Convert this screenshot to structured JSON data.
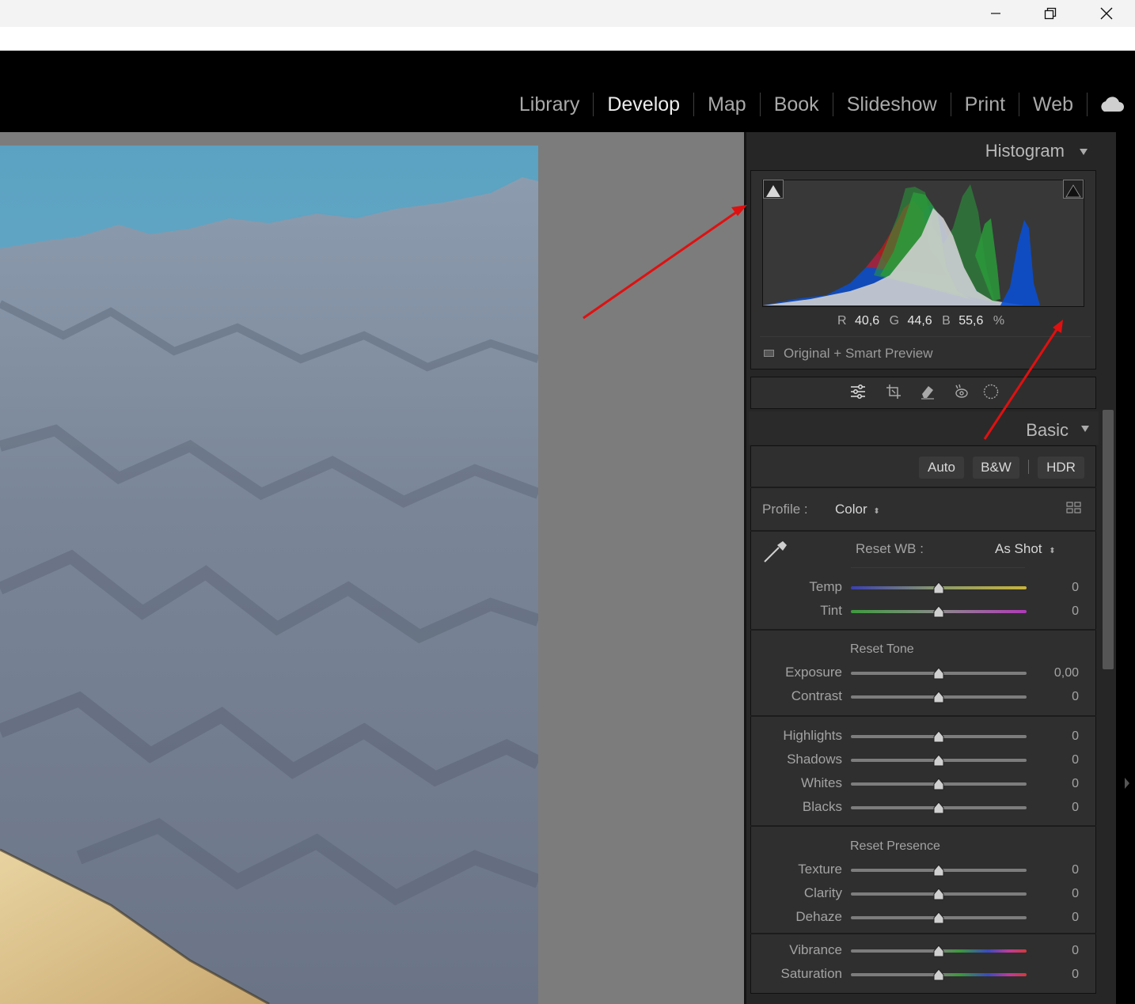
{
  "modules": [
    "Library",
    "Develop",
    "Map",
    "Book",
    "Slideshow",
    "Print",
    "Web"
  ],
  "active_module": "Develop",
  "histogram": {
    "title": "Histogram",
    "r_label": "R",
    "r_value": "40,6",
    "g_label": "G",
    "g_value": "44,6",
    "b_label": "B",
    "b_value": "55,6",
    "unit": "%",
    "preview_status": "Original + Smart Preview"
  },
  "basic": {
    "title": "Basic",
    "auto": "Auto",
    "bw": "B&W",
    "hdr": "HDR",
    "profile_label": "Profile :",
    "profile_value": "Color",
    "reset_wb": "Reset WB :",
    "wb_value": "As Shot",
    "reset_tone": "Reset Tone",
    "reset_presence": "Reset Presence",
    "sliders": {
      "temp": {
        "label": "Temp",
        "value": "0"
      },
      "tint": {
        "label": "Tint",
        "value": "0"
      },
      "exposure": {
        "label": "Exposure",
        "value": "0,00"
      },
      "contrast": {
        "label": "Contrast",
        "value": "0"
      },
      "highlights": {
        "label": "Highlights",
        "value": "0"
      },
      "shadows": {
        "label": "Shadows",
        "value": "0"
      },
      "whites": {
        "label": "Whites",
        "value": "0"
      },
      "blacks": {
        "label": "Blacks",
        "value": "0"
      },
      "texture": {
        "label": "Texture",
        "value": "0"
      },
      "clarity": {
        "label": "Clarity",
        "value": "0"
      },
      "dehaze": {
        "label": "Dehaze",
        "value": "0"
      },
      "vibrance": {
        "label": "Vibrance",
        "value": "0"
      },
      "saturation": {
        "label": "Saturation",
        "value": "0"
      }
    }
  },
  "colors": {
    "annotation_arrow": "#e01010",
    "panel_bg": "#2f2f2f",
    "viewer_bg": "#7c7c7c"
  }
}
